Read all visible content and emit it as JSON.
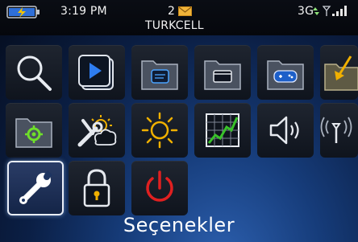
{
  "status": {
    "time": "3:19 PM",
    "message_count": "2",
    "carrier": "TURKCELL",
    "network": "3G"
  },
  "icons": [
    {
      "name": "search-icon",
      "selected": false
    },
    {
      "name": "media-icon",
      "selected": false
    },
    {
      "name": "messages-folder-icon",
      "selected": false
    },
    {
      "name": "applications-folder-icon",
      "selected": false
    },
    {
      "name": "games-folder-icon",
      "selected": false
    },
    {
      "name": "downloads-folder-icon",
      "selected": false
    },
    {
      "name": "settings-folder-icon",
      "selected": false
    },
    {
      "name": "setup-wizard-icon",
      "selected": false
    },
    {
      "name": "brightness-icon",
      "selected": false
    },
    {
      "name": "chart-icon",
      "selected": false
    },
    {
      "name": "sound-icon",
      "selected": false
    },
    {
      "name": "manage-connections-icon",
      "selected": false
    },
    {
      "name": "options-icon",
      "selected": true
    },
    {
      "name": "lock-icon",
      "selected": false
    },
    {
      "name": "power-icon",
      "selected": false
    }
  ],
  "selected_label": "Seçenekler"
}
